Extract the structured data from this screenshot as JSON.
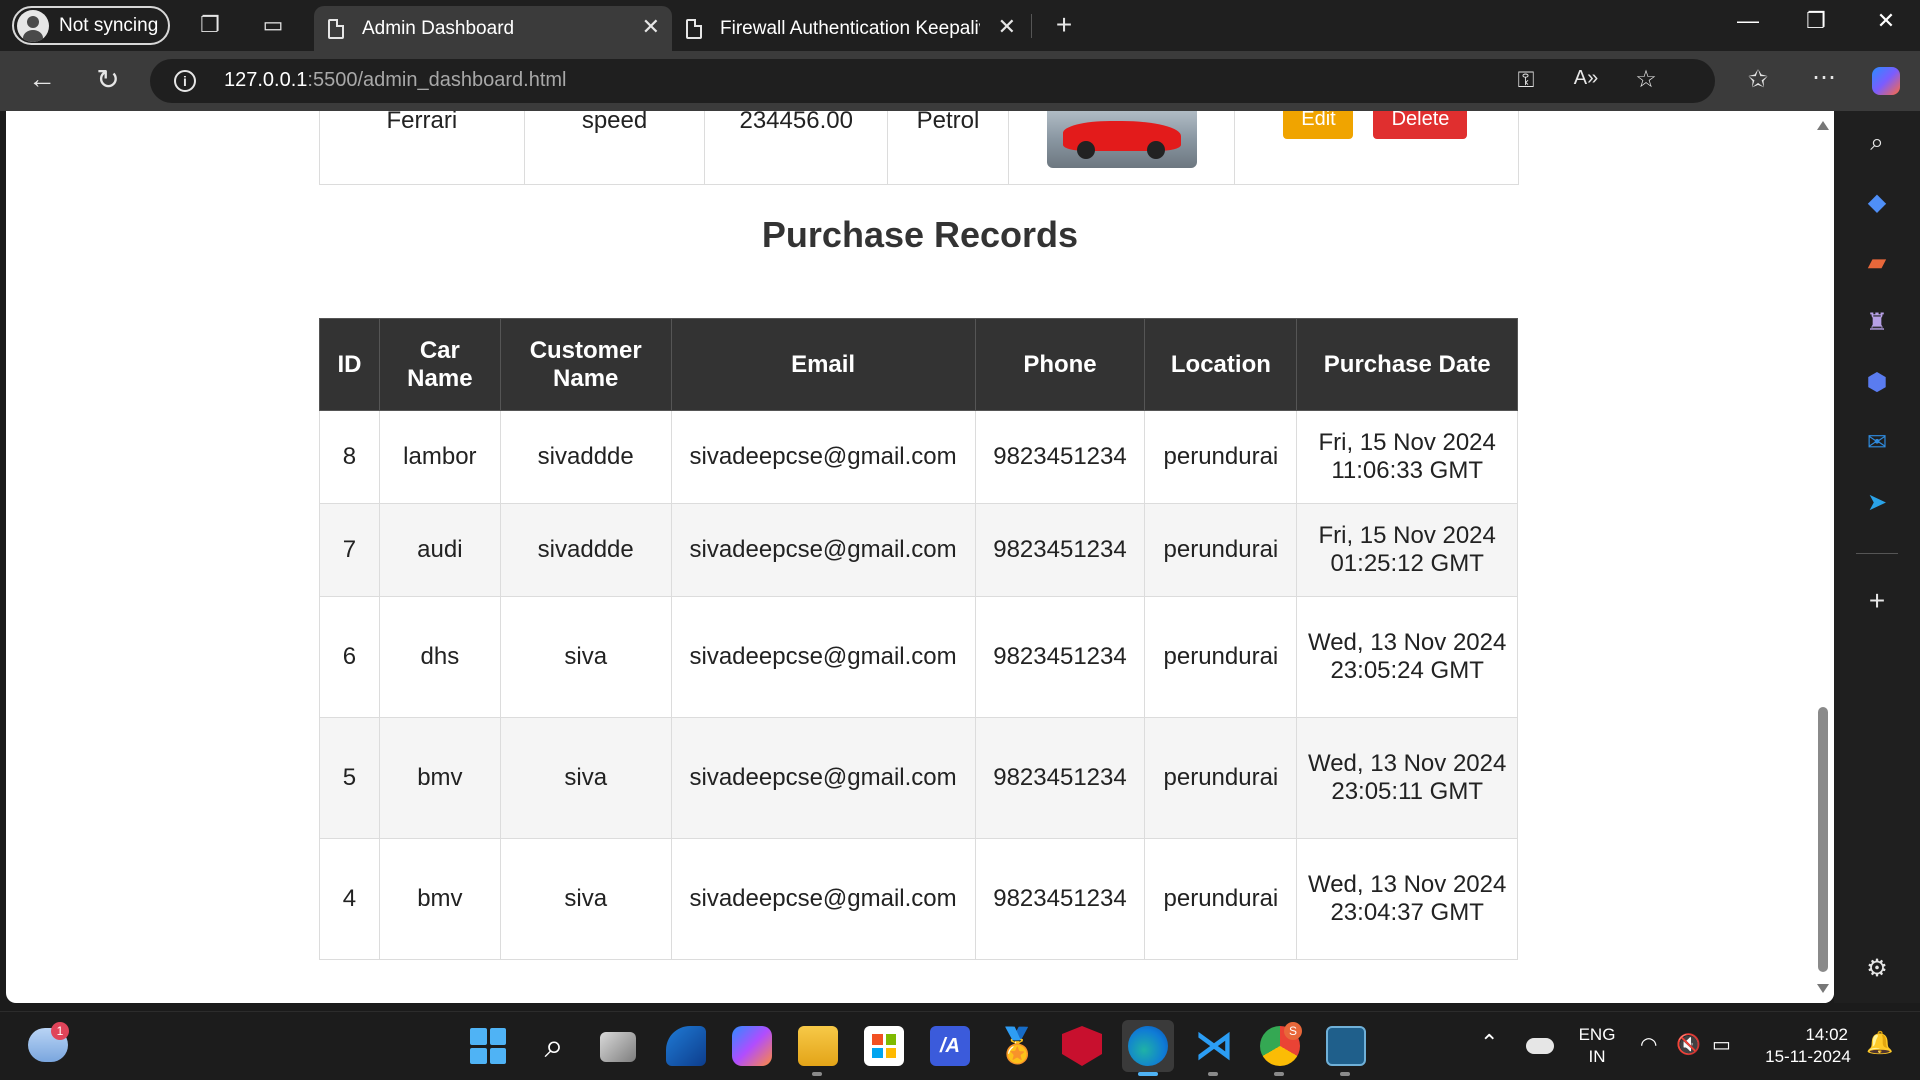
{
  "browser": {
    "profile_label": "Not syncing",
    "tabs": [
      {
        "title": "Admin Dashboard",
        "active": true
      },
      {
        "title": "Firewall Authentication Keepalive",
        "active": false
      }
    ],
    "url_host": "127.0.0.1",
    "url_rest": ":5500/admin_dashboard.html"
  },
  "previous_table_row": {
    "car_name": "Ferrari",
    "model": "speed",
    "price": "234456.00",
    "fuel": "Petrol",
    "edit_label": "Edit",
    "delete_label": "Delete"
  },
  "purchase": {
    "title": "Purchase Records",
    "headers": [
      "ID",
      "Car Name",
      "Customer Name",
      "Email",
      "Phone",
      "Location",
      "Purchase Date"
    ],
    "rows": [
      {
        "id": "8",
        "car": "lambor",
        "customer": "sivaddde",
        "email": "sivadeepcse@gmail.com",
        "phone": "9823451234",
        "location": "perundurai",
        "date": "Fri, 15 Nov 2024 11:06:33 GMT"
      },
      {
        "id": "7",
        "car": "audi",
        "customer": "sivaddde",
        "email": "sivadeepcse@gmail.com",
        "phone": "9823451234",
        "location": "perundurai",
        "date": "Fri, 15 Nov 2024 01:25:12 GMT"
      },
      {
        "id": "6",
        "car": "dhs",
        "customer": "siva",
        "email": "sivadeepcse@gmail.com",
        "phone": "9823451234",
        "location": "perundurai",
        "date": "Wed, 13 Nov 2024 23:05:24 GMT"
      },
      {
        "id": "5",
        "car": "bmv",
        "customer": "siva",
        "email": "sivadeepcse@gmail.com",
        "phone": "9823451234",
        "location": "perundurai",
        "date": "Wed, 13 Nov 2024 23:05:11 GMT"
      },
      {
        "id": "4",
        "car": "bmv",
        "customer": "siva",
        "email": "sivadeepcse@gmail.com",
        "phone": "9823451234",
        "location": "perundurai",
        "date": "Wed, 13 Nov 2024 23:04:37 GMT"
      }
    ]
  },
  "taskbar": {
    "weather_badge": "1",
    "chrome_badge": "S",
    "lang_line1": "ENG",
    "lang_line2": "IN",
    "time": "14:02",
    "date": "15-11-2024"
  },
  "colors": {
    "table_header": "#333333",
    "edit_button": "#f0a400",
    "delete_button": "#e02f2f"
  }
}
